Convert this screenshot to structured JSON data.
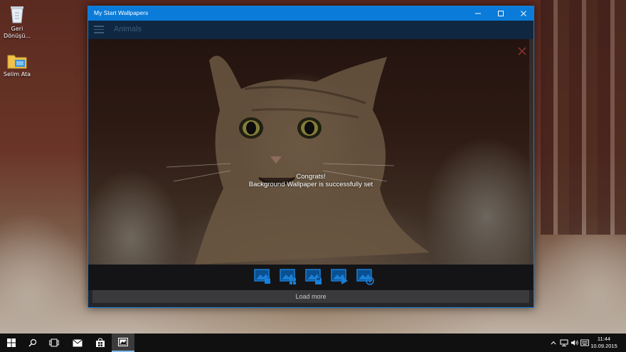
{
  "desktop": {
    "icons": [
      {
        "label": "Geri\nDönüşü..."
      },
      {
        "label": "Selim Ata"
      }
    ]
  },
  "window": {
    "title": "My Start Wallpapers",
    "app_title": "Animals",
    "message_line1": "Congrats!",
    "message_line2": "Background Wallpaper is successfully set",
    "load_more": "Load more",
    "toolbar_icons": [
      "lock-screen-icon",
      "start-screen-icon",
      "save-image-icon",
      "slideshow-icon",
      "share-icon"
    ],
    "accent": "#0a7bd8"
  },
  "taskbar": {
    "clock_time": "11:44",
    "clock_date": "10.09.2015"
  }
}
